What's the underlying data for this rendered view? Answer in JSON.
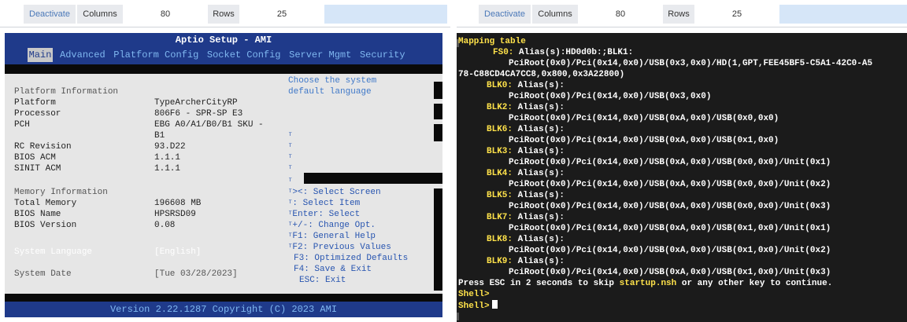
{
  "left": {
    "toolbar": {
      "deactivate": "Deactivate",
      "columns_label": "Columns",
      "columns_value": "80",
      "rows_label": "Rows",
      "rows_value": "25"
    },
    "bios": {
      "title": "Aptio Setup - AMI",
      "menu": [
        "Main",
        "Advanced",
        "Platform Config",
        "Socket Config",
        "Server Mgmt",
        "Security"
      ],
      "platform_info_heading": "Platform Information",
      "platform_label": "Platform",
      "platform_value": "TypeArcherCityRP",
      "processor_label": "Processor",
      "processor_value": "806F6 - SPR-SP E3",
      "pch_label": "PCH",
      "pch_value_1": "EBG A0/A1/B0/B1 SKU -",
      "pch_value_2": "B1",
      "rc_label": "RC Revision",
      "rc_value": "93.D22",
      "bios_acm_label": "BIOS ACM",
      "bios_acm_value": "1.1.1",
      "sinit_acm_label": "SINIT ACM",
      "sinit_acm_value": "1.1.1",
      "memory_info_heading": "Memory Information",
      "total_memory_label": "Total Memory",
      "total_memory_value": "196608 MB",
      "bios_name_label": "BIOS Name",
      "bios_name_value": "HPSRSD09",
      "bios_version_label": "BIOS Version",
      "bios_version_value": "0.08",
      "system_language_label": "System Language",
      "system_language_value": "[English]",
      "system_date_label": "System Date",
      "system_date_value": "[Tue 03/28/2023]",
      "help_top_1": "Choose the system",
      "help_top_2": "default language",
      "keys": [
        "><: Select Screen",
        ": Select Item",
        "Enter: Select",
        "+/-: Change Opt.",
        "F1: General Help",
        "F2: Previous Values",
        "F3: Optimized Defaults",
        "F4: Save & Exit",
        "ESC: Exit"
      ],
      "footer": "Version 2.22.1287 Copyright (C) 2023 AMI"
    }
  },
  "right": {
    "toolbar": {
      "deactivate": "Deactivate",
      "columns_label": "Columns",
      "columns_value": "80",
      "rows_label": "Rows",
      "rows_value": "25"
    },
    "shell": {
      "heading": "Mapping table",
      "fs0_name": "FS0:",
      "fs0_alias": " Alias(s):HD0d0b:;BLK1:",
      "fs0_path_1": "PciRoot(0x0)/Pci(0x14,0x0)/USB(0x3,0x0)/HD(1,GPT,FEE45BF5-C5A1-42C0-A5",
      "fs0_path_2": "78-C88CD4CA7CC8,0x800,0x3A22800)",
      "devices": [
        {
          "name": "BLK0:",
          "alias": " Alias(s):",
          "path": "PciRoot(0x0)/Pci(0x14,0x0)/USB(0x3,0x0)"
        },
        {
          "name": "BLK2:",
          "alias": " Alias(s):",
          "path": "PciRoot(0x0)/Pci(0x14,0x0)/USB(0xA,0x0)/USB(0x0,0x0)"
        },
        {
          "name": "BLK6:",
          "alias": " Alias(s):",
          "path": "PciRoot(0x0)/Pci(0x14,0x0)/USB(0xA,0x0)/USB(0x1,0x0)"
        },
        {
          "name": "BLK3:",
          "alias": " Alias(s):",
          "path": "PciRoot(0x0)/Pci(0x14,0x0)/USB(0xA,0x0)/USB(0x0,0x0)/Unit(0x1)"
        },
        {
          "name": "BLK4:",
          "alias": " Alias(s):",
          "path": "PciRoot(0x0)/Pci(0x14,0x0)/USB(0xA,0x0)/USB(0x0,0x0)/Unit(0x2)"
        },
        {
          "name": "BLK5:",
          "alias": " Alias(s):",
          "path": "PciRoot(0x0)/Pci(0x14,0x0)/USB(0xA,0x0)/USB(0x0,0x0)/Unit(0x3)"
        },
        {
          "name": "BLK7:",
          "alias": " Alias(s):",
          "path": "PciRoot(0x0)/Pci(0x14,0x0)/USB(0xA,0x0)/USB(0x1,0x0)/Unit(0x1)"
        },
        {
          "name": "BLK8:",
          "alias": " Alias(s):",
          "path": "PciRoot(0x0)/Pci(0x14,0x0)/USB(0xA,0x0)/USB(0x1,0x0)/Unit(0x2)"
        },
        {
          "name": "BLK9:",
          "alias": " Alias(s):",
          "path": "PciRoot(0x0)/Pci(0x14,0x0)/USB(0xA,0x0)/USB(0x1,0x0)/Unit(0x3)"
        }
      ],
      "esc_prefix": "Press ESC in 2 seconds to skip ",
      "esc_file": "startup.nsh",
      "esc_suffix": " or any other key to continue.",
      "prompt_1": "Shell>",
      "prompt_2": "Shell>"
    }
  }
}
